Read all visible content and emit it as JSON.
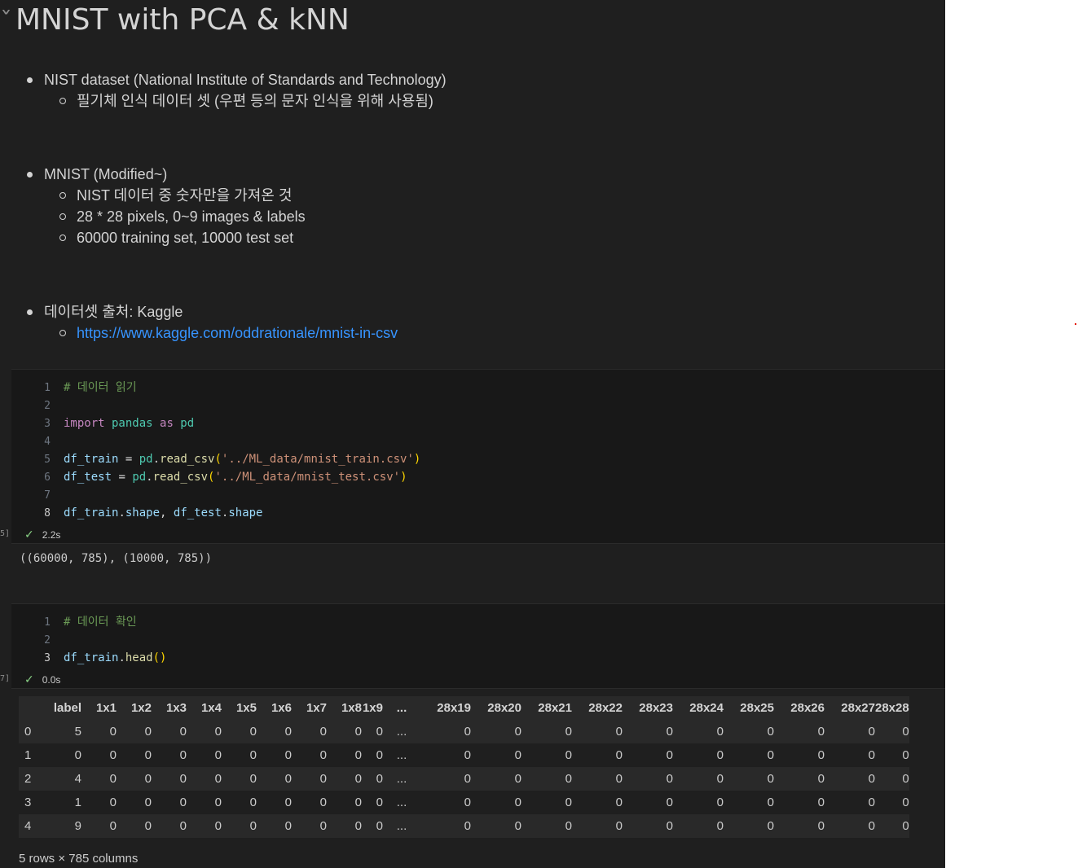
{
  "title": "MNIST with PCA & kNN",
  "markdown": {
    "groups": [
      {
        "text": "NIST dataset (National Institute of Standards and Technology)",
        "sub": [
          "필기체 인식 데이터 셋 (우편 등의 문자 인식을 위해 사용됨)"
        ]
      },
      {
        "text": "MNIST (Modified~)",
        "sub": [
          "NIST 데이터 중 숫자만을 가져온 것",
          "28 * 28 pixels, 0~9 images & labels",
          "60000 training set, 10000 test set"
        ]
      },
      {
        "text": "데이터셋 출처: Kaggle",
        "sub": [
          "https://www.kaggle.com/oddrationale/mnist-in-csv"
        ]
      }
    ]
  },
  "cells": [
    {
      "exec_mark": "5]",
      "lines": [
        [
          {
            "t": "# 데이터 읽기",
            "c": "cm"
          }
        ],
        [],
        [
          {
            "t": "import",
            "c": "kw"
          },
          {
            "t": " pandas ",
            "c": "mod"
          },
          {
            "t": "as",
            "c": "kw"
          },
          {
            "t": " pd",
            "c": "mod"
          }
        ],
        [],
        [
          {
            "t": "df_train",
            "c": "var"
          },
          {
            "t": " = ",
            "c": "op"
          },
          {
            "t": "pd",
            "c": "mod"
          },
          {
            "t": ".",
            "c": "op"
          },
          {
            "t": "read_csv",
            "c": "fn"
          },
          {
            "t": "(",
            "c": "paren"
          },
          {
            "t": "'../ML_data/mnist_train.csv'",
            "c": "str"
          },
          {
            "t": ")",
            "c": "paren"
          }
        ],
        [
          {
            "t": "df_test",
            "c": "var"
          },
          {
            "t": " = ",
            "c": "op"
          },
          {
            "t": "pd",
            "c": "mod"
          },
          {
            "t": ".",
            "c": "op"
          },
          {
            "t": "read_csv",
            "c": "fn"
          },
          {
            "t": "(",
            "c": "paren"
          },
          {
            "t": "'../ML_data/mnist_test.csv'",
            "c": "str"
          },
          {
            "t": ")",
            "c": "paren"
          }
        ],
        [],
        [
          {
            "t": "df_train",
            "c": "var"
          },
          {
            "t": ".",
            "c": "op"
          },
          {
            "t": "shape",
            "c": "var"
          },
          {
            "t": ", ",
            "c": "op"
          },
          {
            "t": "df_test",
            "c": "var"
          },
          {
            "t": ".",
            "c": "op"
          },
          {
            "t": "shape",
            "c": "var"
          }
        ]
      ],
      "status": "2.2s",
      "output": "((60000, 785), (10000, 785))"
    },
    {
      "exec_mark": "7]",
      "lines": [
        [
          {
            "t": "# 데이터 확인",
            "c": "cm"
          }
        ],
        [],
        [
          {
            "t": "df_train",
            "c": "var"
          },
          {
            "t": ".",
            "c": "op"
          },
          {
            "t": "head",
            "c": "fn"
          },
          {
            "t": "()",
            "c": "paren"
          }
        ]
      ],
      "status": "0.0s"
    }
  ],
  "dataframe": {
    "columns": [
      "label",
      "1x1",
      "1x2",
      "1x3",
      "1x4",
      "1x5",
      "1x6",
      "1x7",
      "1x8",
      "1x9",
      "...",
      "28x19",
      "28x20",
      "28x21",
      "28x22",
      "28x23",
      "28x24",
      "28x25",
      "28x26",
      "28x27",
      "28x28"
    ],
    "rows": [
      {
        "index": "0",
        "values": [
          "5",
          "0",
          "0",
          "0",
          "0",
          "0",
          "0",
          "0",
          "0",
          "0",
          "...",
          "0",
          "0",
          "0",
          "0",
          "0",
          "0",
          "0",
          "0",
          "0",
          "0"
        ]
      },
      {
        "index": "1",
        "values": [
          "0",
          "0",
          "0",
          "0",
          "0",
          "0",
          "0",
          "0",
          "0",
          "0",
          "...",
          "0",
          "0",
          "0",
          "0",
          "0",
          "0",
          "0",
          "0",
          "0",
          "0"
        ]
      },
      {
        "index": "2",
        "values": [
          "4",
          "0",
          "0",
          "0",
          "0",
          "0",
          "0",
          "0",
          "0",
          "0",
          "...",
          "0",
          "0",
          "0",
          "0",
          "0",
          "0",
          "0",
          "0",
          "0",
          "0"
        ]
      },
      {
        "index": "3",
        "values": [
          "1",
          "0",
          "0",
          "0",
          "0",
          "0",
          "0",
          "0",
          "0",
          "0",
          "...",
          "0",
          "0",
          "0",
          "0",
          "0",
          "0",
          "0",
          "0",
          "0",
          "0"
        ]
      },
      {
        "index": "4",
        "values": [
          "9",
          "0",
          "0",
          "0",
          "0",
          "0",
          "0",
          "0",
          "0",
          "0",
          "...",
          "0",
          "0",
          "0",
          "0",
          "0",
          "0",
          "0",
          "0",
          "0",
          "0"
        ]
      }
    ],
    "footer": "5 rows × 785 columns"
  },
  "colors": {
    "editor_bg": "#1f1f1f",
    "cell_bg": "#181818",
    "link": "#3794ff",
    "check": "#89d185"
  }
}
